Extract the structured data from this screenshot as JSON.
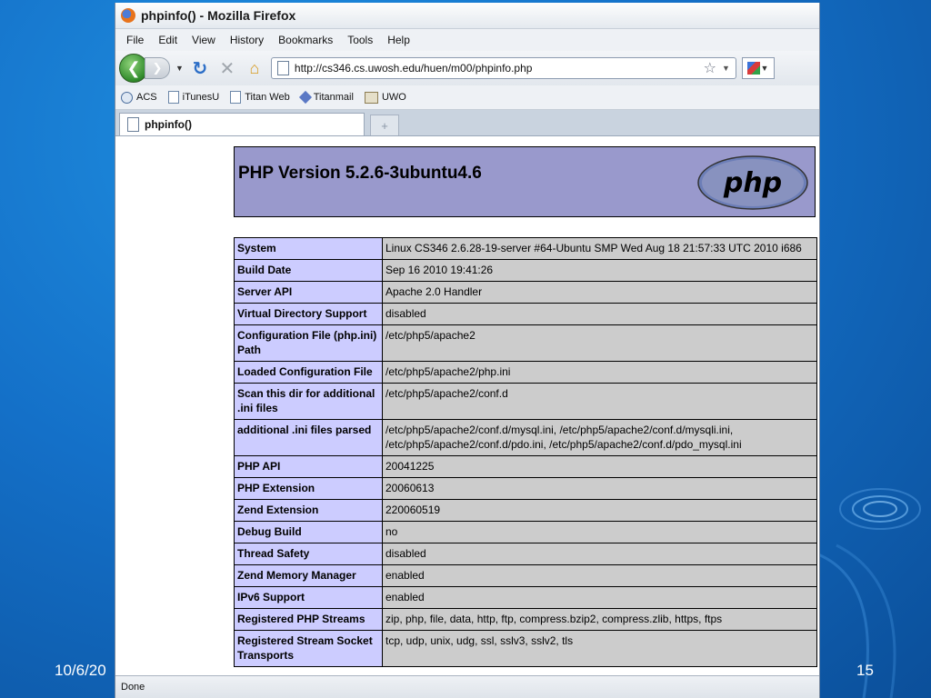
{
  "slide": {
    "date": "10/6/20",
    "number": "15"
  },
  "window": {
    "title": "phpinfo() - Mozilla Firefox"
  },
  "menu": [
    "File",
    "Edit",
    "View",
    "History",
    "Bookmarks",
    "Tools",
    "Help"
  ],
  "nav": {
    "url": "http://cs346.cs.uwosh.edu/huen/m00/phpinfo.php"
  },
  "bookmarks": [
    "ACS",
    "iTunesU",
    "Titan Web",
    "Titanmail",
    "UWO"
  ],
  "tab": {
    "label": "phpinfo()",
    "newtab_icon": "plus"
  },
  "page": {
    "version": "PHP Version 5.2.6-3ubuntu4.6",
    "logo_text": "php",
    "rows": [
      {
        "key": "System",
        "value": "Linux CS346 2.6.28-19-server #64-Ubuntu SMP Wed Aug 18 21:57:33 UTC 2010 i686"
      },
      {
        "key": "Build Date",
        "value": "Sep 16 2010 19:41:26"
      },
      {
        "key": "Server API",
        "value": "Apache 2.0 Handler"
      },
      {
        "key": "Virtual Directory Support",
        "value": "disabled"
      },
      {
        "key": "Configuration File (php.ini) Path",
        "value": "/etc/php5/apache2"
      },
      {
        "key": "Loaded Configuration File",
        "value": "/etc/php5/apache2/php.ini"
      },
      {
        "key": "Scan this dir for additional .ini files",
        "value": "/etc/php5/apache2/conf.d"
      },
      {
        "key": "additional .ini files parsed",
        "value": "/etc/php5/apache2/conf.d/mysql.ini, /etc/php5/apache2/conf.d/mysqli.ini, /etc/php5/apache2/conf.d/pdo.ini, /etc/php5/apache2/conf.d/pdo_mysql.ini"
      },
      {
        "key": "PHP API",
        "value": "20041225"
      },
      {
        "key": "PHP Extension",
        "value": "20060613"
      },
      {
        "key": "Zend Extension",
        "value": "220060519"
      },
      {
        "key": "Debug Build",
        "value": "no"
      },
      {
        "key": "Thread Safety",
        "value": "disabled"
      },
      {
        "key": "Zend Memory Manager",
        "value": "enabled"
      },
      {
        "key": "IPv6 Support",
        "value": "enabled"
      },
      {
        "key": "Registered PHP Streams",
        "value": "zip, php, file, data, http, ftp, compress.bzip2, compress.zlib, https, ftps"
      },
      {
        "key": "Registered Stream Socket Transports",
        "value": "tcp, udp, unix, udg, ssl, sslv3, sslv2, tls"
      }
    ]
  },
  "status": {
    "text": "Done"
  },
  "colors": {
    "header_bg": "#9999cc",
    "key_bg": "#ccccff",
    "value_bg": "#cccccc",
    "slide_bg": "#1470c8"
  }
}
